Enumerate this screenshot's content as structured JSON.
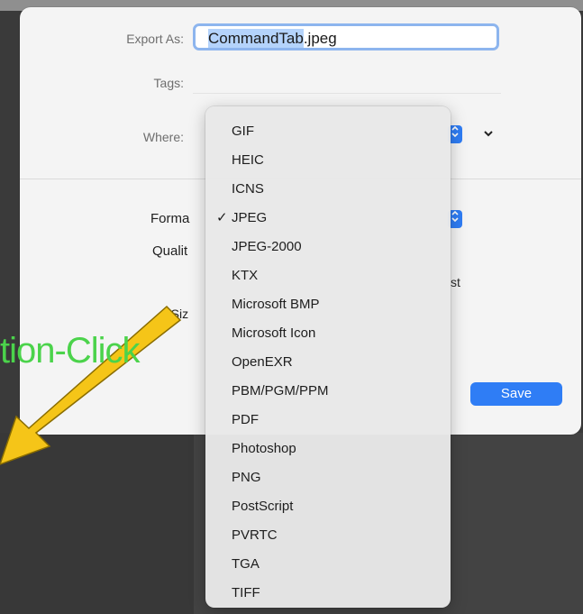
{
  "dialog": {
    "export_as_label": "Export As:",
    "file_name_base": "CommandTab",
    "file_name_ext": ".jpeg",
    "tags_label": "Tags:",
    "where_label": "Where:",
    "format_label": "Forma",
    "quality_label": "Qualit",
    "file_size_label": "e Siz",
    "best_label": "st",
    "save_label": "Save"
  },
  "format_menu": {
    "selected": "JPEG",
    "items": [
      "GIF",
      "HEIC",
      "ICNS",
      "JPEG",
      "JPEG-2000",
      "KTX",
      "Microsoft BMP",
      "Microsoft Icon",
      "OpenEXR",
      "PBM/PGM/PPM",
      "PDF",
      "Photoshop",
      "PNG",
      "PostScript",
      "PVRTC",
      "TGA",
      "TIFF"
    ]
  },
  "annotation": {
    "text": "tion-Click",
    "text_color": "#4bd34b",
    "arrow_color": "#f5c518"
  },
  "colors": {
    "accent": "#2f7df5",
    "dialog_bg": "#f4f4f4",
    "menu_bg": "#e8e8e8"
  },
  "icons": {
    "checkmark": "checkmark-icon",
    "stepper": "up-down-chevron-icon",
    "expand": "chevron-down-icon"
  }
}
